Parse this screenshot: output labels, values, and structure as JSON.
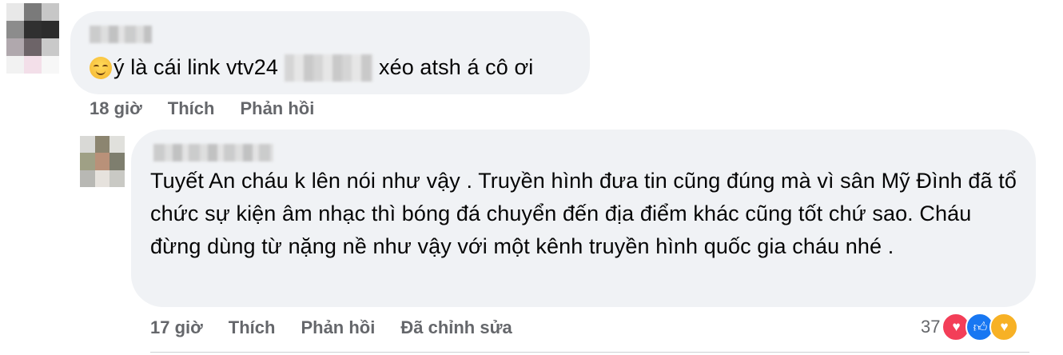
{
  "comments": [
    {
      "text_before": "ý là cái link vtv24",
      "text_after": "xéo atsh á cô ơi",
      "time": "18 giờ",
      "like_label": "Thích",
      "reply_label": "Phản hồi"
    },
    {
      "text": "Tuyết An cháu k lên nói như vậy . Truyền hình đưa tin cũng đúng mà vì sân Mỹ Đình đã tổ chức sự kiện âm nhạc thì bóng đá chuyển đến địa điểm khác cũng tốt chứ sao. Cháu đừng dùng từ nặng nề như vậy với một kênh truyền hình quốc gia cháu nhé .",
      "time": "17 giờ",
      "like_label": "Thích",
      "reply_label": "Phản hồi",
      "edited_label": "Đã chỉnh sửa",
      "reaction_count": "37",
      "reaction_icons": [
        "love-icon",
        "like-icon",
        "care-icon"
      ]
    }
  ],
  "colors": {
    "bubble": "#f0f2f5",
    "meta_text": "#65676b",
    "love": "#f33e58",
    "like": "#1877f2",
    "care": "#f7b125"
  }
}
